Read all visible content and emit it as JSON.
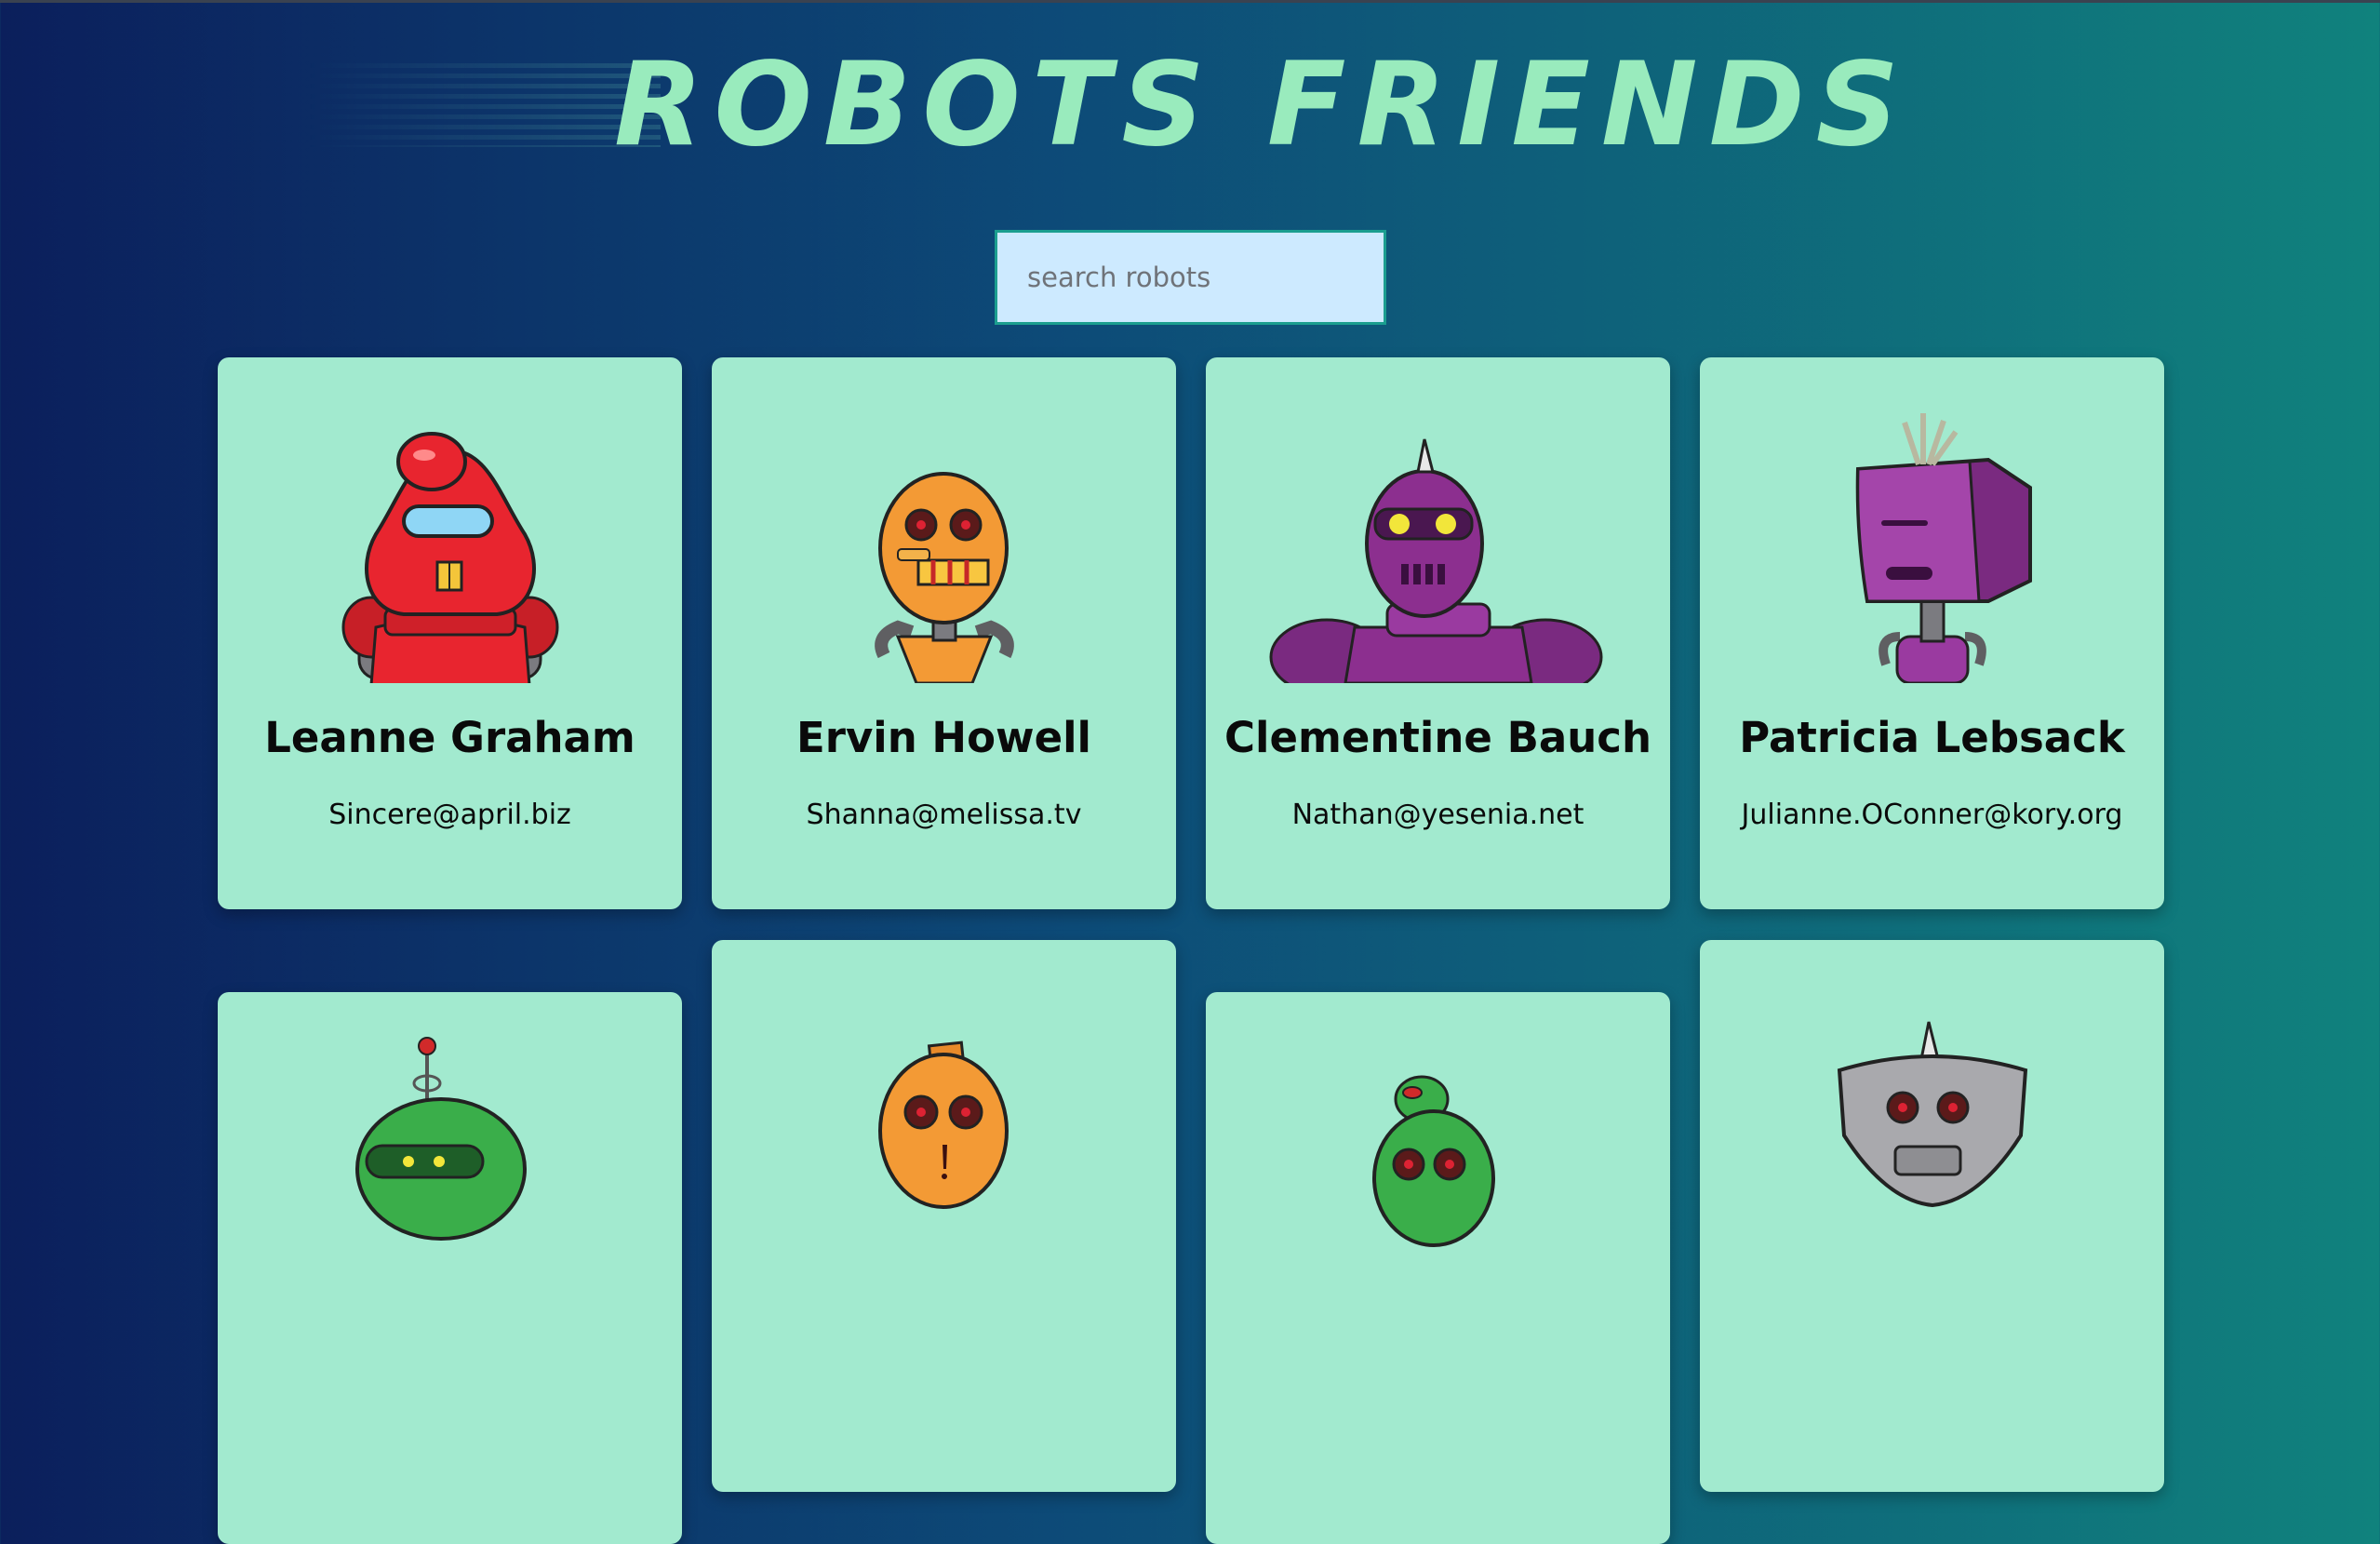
{
  "header": {
    "title": "ROBOTS FRIENDS"
  },
  "search": {
    "placeholder": "search robots",
    "value": ""
  },
  "robots": [
    {
      "name": "Leanne Graham",
      "email": "Sincere@april.biz",
      "color": "#e8252f"
    },
    {
      "name": "Ervin Howell",
      "email": "Shanna@melissa.tv",
      "color": "#f39a35"
    },
    {
      "name": "Clementine Bauch",
      "email": "Nathan@yesenia.net",
      "color": "#8c2f8f"
    },
    {
      "name": "Patricia Lebsack",
      "email": "Julianne.OConner@kory.org",
      "color": "#9a3aa0"
    },
    {
      "name": "",
      "email": "",
      "color": "#3aae4a"
    },
    {
      "name": "",
      "email": "",
      "color": "#f39a35"
    },
    {
      "name": "",
      "email": "",
      "color": "#3aae4a"
    },
    {
      "name": "",
      "email": "",
      "color": "#a9a9ad"
    }
  ]
}
